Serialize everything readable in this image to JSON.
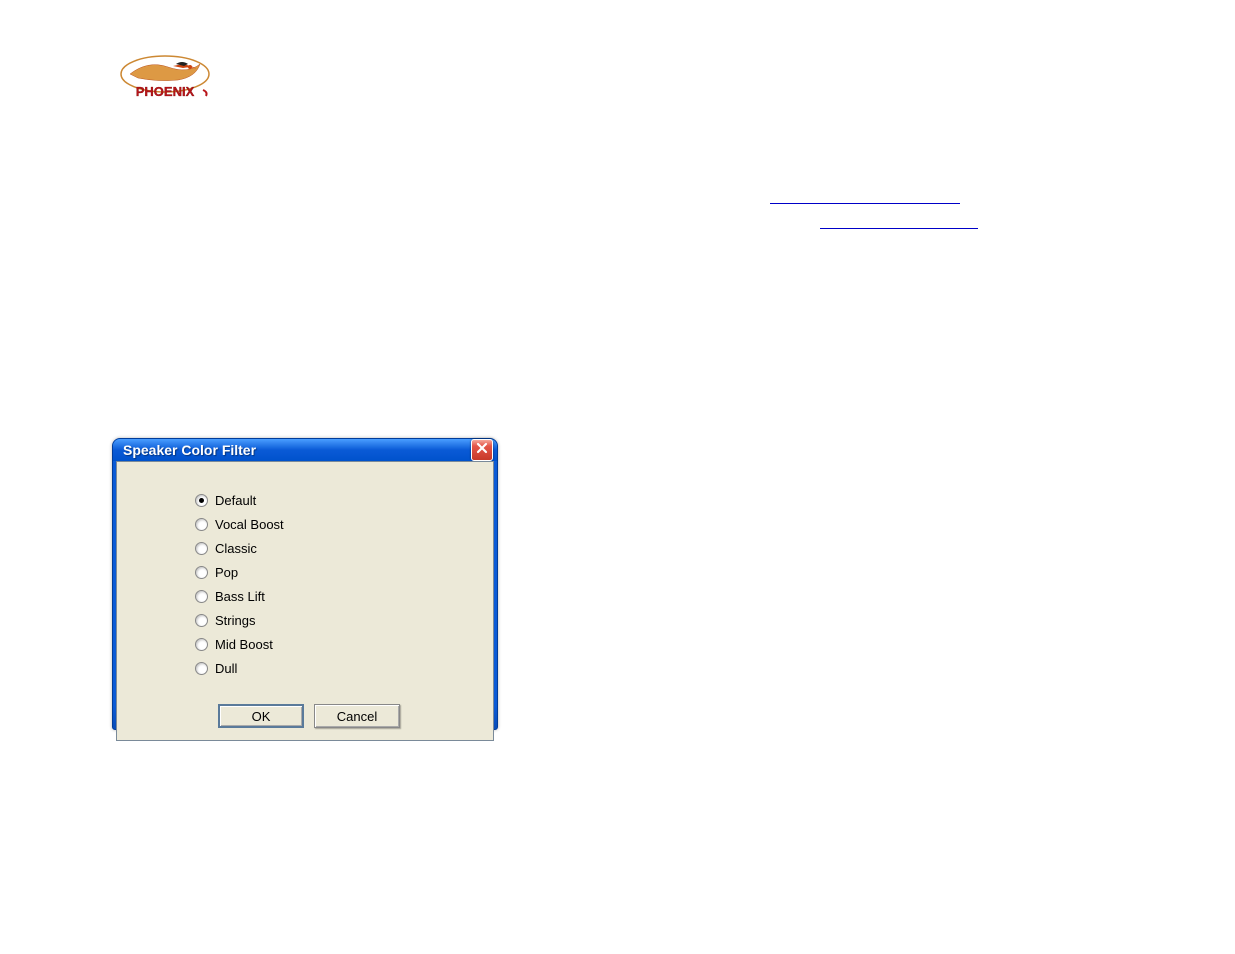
{
  "links": {
    "link1_text": " ",
    "link2_text": " "
  },
  "dialog": {
    "title": "Speaker Color Filter",
    "options": [
      {
        "label": "Default",
        "selected": true
      },
      {
        "label": "Vocal Boost",
        "selected": false
      },
      {
        "label": "Classic",
        "selected": false
      },
      {
        "label": "Pop",
        "selected": false
      },
      {
        "label": "Bass Lift",
        "selected": false
      },
      {
        "label": "Strings",
        "selected": false
      },
      {
        "label": "Mid Boost",
        "selected": false
      },
      {
        "label": "Dull",
        "selected": false
      }
    ],
    "buttons": {
      "ok": "OK",
      "cancel": "Cancel"
    }
  }
}
